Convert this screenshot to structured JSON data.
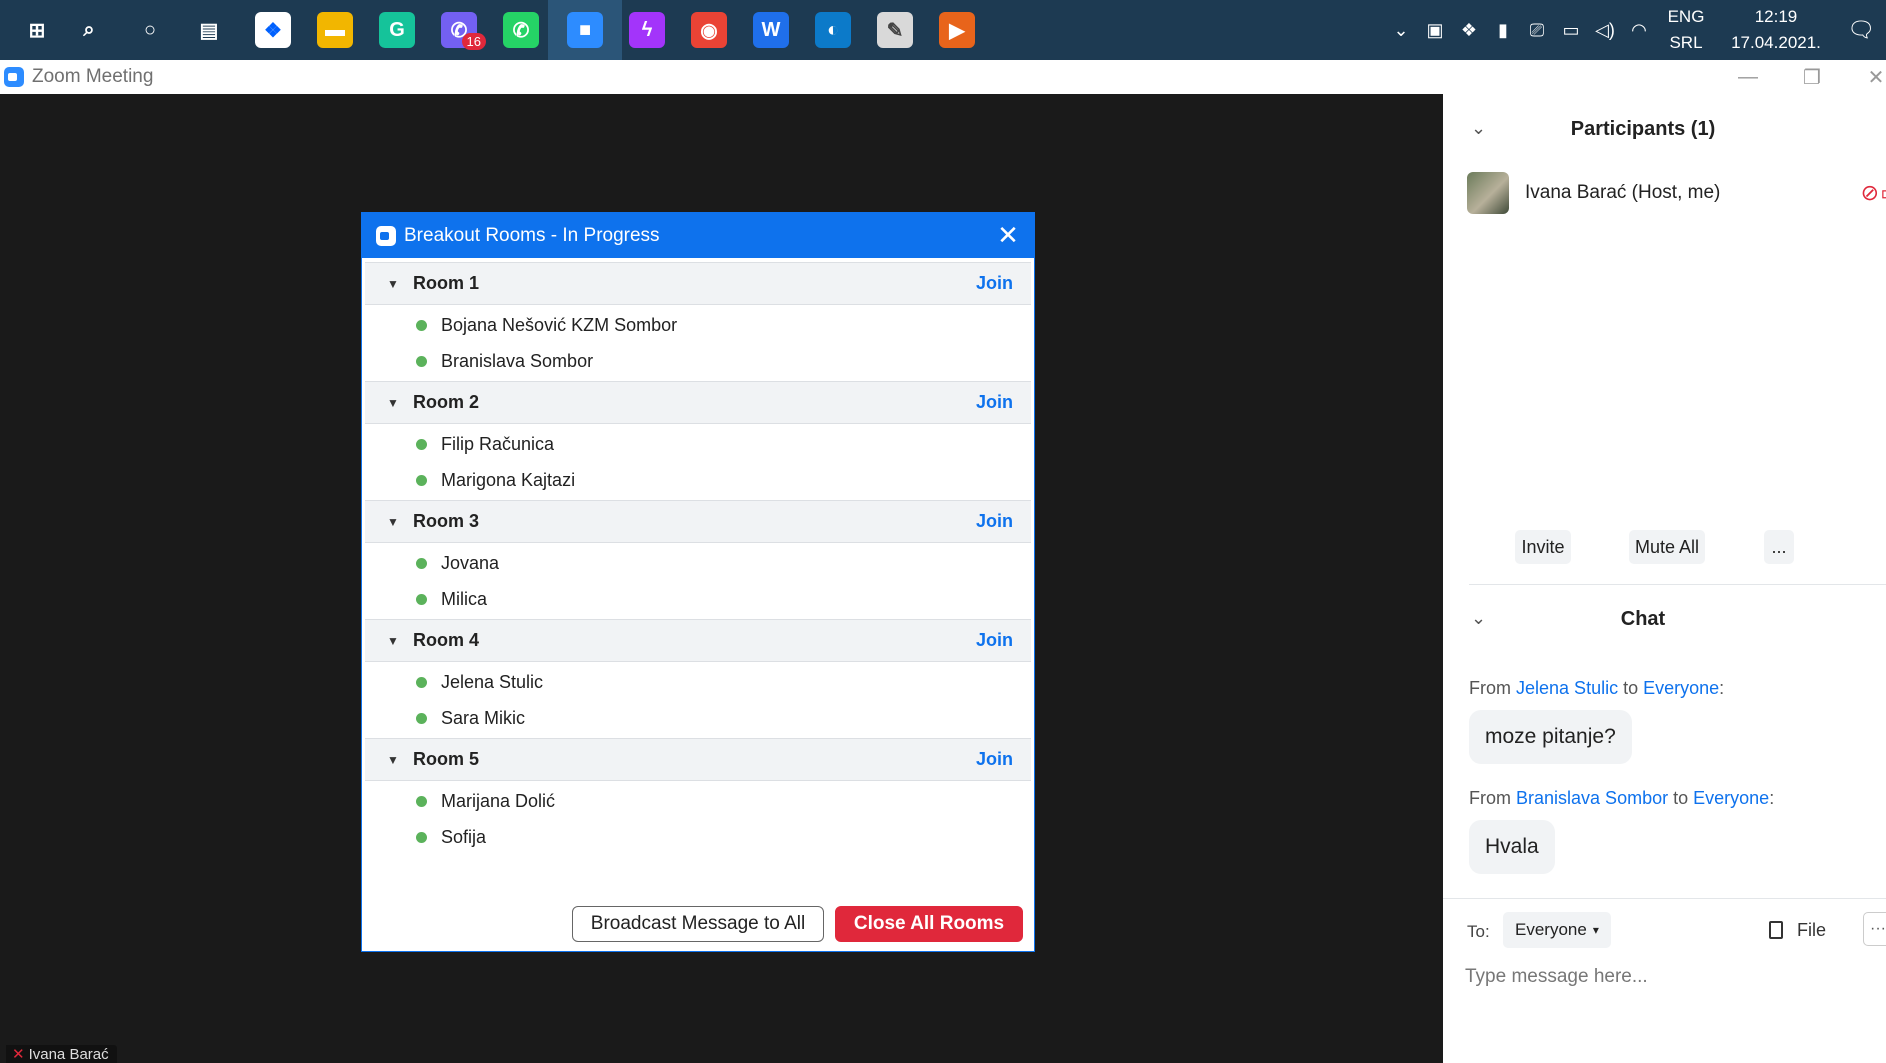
{
  "taskbar": {
    "apps": [
      {
        "name": "windows-start",
        "glyph": "⊞"
      },
      {
        "name": "search",
        "glyph": "⌕"
      },
      {
        "name": "cortana",
        "glyph": "○"
      },
      {
        "name": "task-view",
        "glyph": "▤"
      },
      {
        "name": "dropbox",
        "glyph": "❖"
      },
      {
        "name": "file-explorer",
        "glyph": "▬"
      },
      {
        "name": "grammarly",
        "glyph": "G"
      },
      {
        "name": "viber",
        "glyph": "✆",
        "badge": "16"
      },
      {
        "name": "whatsapp",
        "glyph": "✆"
      },
      {
        "name": "zoom",
        "glyph": "■"
      },
      {
        "name": "messenger",
        "glyph": "ϟ"
      },
      {
        "name": "chrome",
        "glyph": "◉"
      },
      {
        "name": "wps-writer",
        "glyph": "W"
      },
      {
        "name": "edge",
        "glyph": "◐"
      },
      {
        "name": "paint",
        "glyph": "✎"
      },
      {
        "name": "media-player",
        "glyph": "▶"
      }
    ],
    "lang_top": "ENG",
    "lang_bottom": "SRL",
    "time": "12:19",
    "date": "17.04.2021."
  },
  "window": {
    "title": "Zoom Meeting"
  },
  "meeting": {
    "self_name": "Ivana Barać"
  },
  "breakout": {
    "title": "Breakout Rooms - In Progress",
    "join_label": "Join",
    "rooms": [
      {
        "name": "Room 1",
        "members": [
          "Bojana Nešović KZM Sombor",
          "Branislava Sombor"
        ]
      },
      {
        "name": "Room 2",
        "members": [
          "Filip Računica",
          "Marigona Kajtazi"
        ]
      },
      {
        "name": "Room 3",
        "members": [
          "Jovana",
          "Milica"
        ]
      },
      {
        "name": "Room 4",
        "members": [
          "Jelena Stulic",
          "Sara Mikic"
        ]
      },
      {
        "name": "Room 5",
        "members": [
          "Marijana Dolić",
          "Sofija"
        ]
      }
    ],
    "broadcast_label": "Broadcast Message to All",
    "close_all_label": "Close All Rooms"
  },
  "participants": {
    "title": "Participants (1)",
    "list": [
      {
        "name": "Ivana Barać (Host, me)"
      }
    ],
    "invite_label": "Invite",
    "mute_all_label": "Mute All",
    "more_label": "..."
  },
  "chat": {
    "title": "Chat",
    "messages": [
      {
        "from_prefix": "From",
        "sender": "Jelena Stulic",
        "to_word": "to",
        "recipient": "Everyone",
        "text": "moze pitanje?"
      },
      {
        "from_prefix": "From",
        "sender": "Branislava Sombor",
        "to_word": "to",
        "recipient": "Everyone",
        "text": "Hvala"
      }
    ],
    "to_label": "To:",
    "to_value": "Everyone",
    "file_label": "File",
    "more_label": "···",
    "input_placeholder": "Type message here..."
  },
  "colors": {
    "accent": "#0e72ed",
    "danger": "#e0283b",
    "online": "#5bb25b",
    "taskbar": "#1d3a52"
  }
}
